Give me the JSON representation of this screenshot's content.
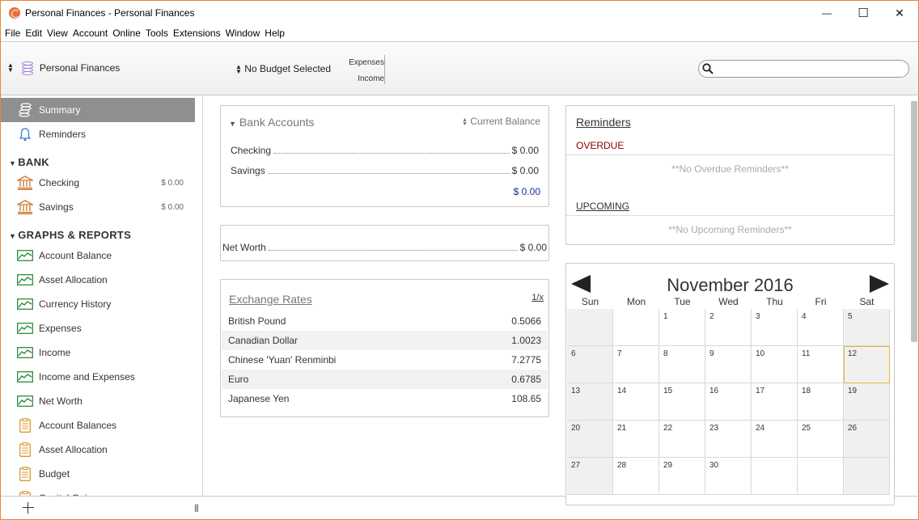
{
  "window": {
    "title": "Personal Finances - Personal Finances",
    "controls": {
      "minimize": "—",
      "maximize": "☐",
      "close": "✕"
    }
  },
  "menu": [
    "File",
    "Edit",
    "View",
    "Account",
    "Online",
    "Tools",
    "Extensions",
    "Window",
    "Help"
  ],
  "toolbar": {
    "account_selector": "Personal Finances",
    "budget_selector": "No Budget Selected",
    "expenses_label": "Expenses",
    "income_label": "Income",
    "search": {
      "value": "",
      "placeholder": ""
    }
  },
  "sidebar": {
    "top_items": [
      {
        "label": "Summary",
        "icon": "coins-icon",
        "selected": true
      },
      {
        "label": "Reminders",
        "icon": "bell-icon",
        "selected": false
      }
    ],
    "bank_section": "BANK",
    "bank_accounts": [
      {
        "label": "Checking",
        "amount": "$ 0.00",
        "icon": "bank-icon"
      },
      {
        "label": "Savings",
        "amount": "$ 0.00",
        "icon": "bank-icon"
      }
    ],
    "reports_section": "GRAPHS & REPORTS",
    "graphs": [
      "Account Balance",
      "Asset Allocation",
      "Currency History",
      "Expenses",
      "Income",
      "Income and Expenses",
      "Net Worth"
    ],
    "reports": [
      "Account Balances",
      "Asset Allocation",
      "Budget",
      "Capital Gains"
    ]
  },
  "bank_accounts_panel": {
    "title": "Bank Accounts",
    "sort_label": "Current Balance",
    "rows": [
      {
        "name": "Checking",
        "amount": "$ 0.00"
      },
      {
        "name": "Savings",
        "amount": "$ 0.00"
      }
    ],
    "total": "$ 0.00"
  },
  "net_worth_panel": {
    "label": "Net Worth",
    "amount": "$ 0.00"
  },
  "exchange_rates_panel": {
    "title": "Exchange Rates",
    "toggle": "1/x",
    "rows": [
      {
        "currency": "British Pound",
        "rate": "0.5066"
      },
      {
        "currency": "Canadian Dollar",
        "rate": "1.0023"
      },
      {
        "currency": "Chinese 'Yuan' Renminbi",
        "rate": "7.2775"
      },
      {
        "currency": "Euro",
        "rate": "0.6785"
      },
      {
        "currency": "Japanese Yen",
        "rate": "108.65"
      }
    ]
  },
  "reminders_panel": {
    "title": "Reminders",
    "overdue_label": "OVERDUE",
    "overdue_empty": "**No Overdue Reminders**",
    "upcoming_label": "UPCOMING",
    "upcoming_empty": "**No Upcoming Reminders**"
  },
  "calendar": {
    "month": "November 2016",
    "days_of_week": [
      "Sun",
      "Mon",
      "Tue",
      "Wed",
      "Thu",
      "Fri",
      "Sat"
    ],
    "weeks": [
      [
        "",
        "",
        "1",
        "2",
        "3",
        "4",
        "5"
      ],
      [
        "6",
        "7",
        "8",
        "9",
        "10",
        "11",
        "12"
      ],
      [
        "13",
        "14",
        "15",
        "16",
        "17",
        "18",
        "19"
      ],
      [
        "20",
        "21",
        "22",
        "23",
        "24",
        "25",
        "26"
      ],
      [
        "27",
        "28",
        "29",
        "30",
        "",
        "",
        ""
      ]
    ],
    "today": "12"
  },
  "colors": {
    "accent_orange": "#e5873a",
    "selected_item": "#8f8f8f",
    "overdue_red": "#8b0000",
    "total_blue": "#1a2c9c",
    "today_outline": "#e2b43b"
  }
}
